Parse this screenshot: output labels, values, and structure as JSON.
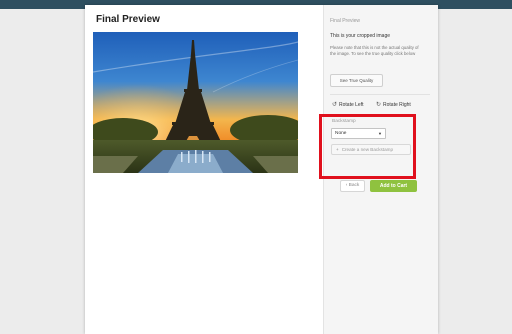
{
  "modal": {
    "title": "Final Preview",
    "close_icon": "close-icon"
  },
  "preview": {
    "image_alt": "Eiffel Tower at sunset over the Trocadéro fountains"
  },
  "sidebar": {
    "heading": "Final Preview",
    "crop_text": "This is your cropped image",
    "note": "Please note that this is not the actual quality of the image. To see the true quality click below",
    "quality_button": "See True Quality",
    "rotate_left": "Rotate Left",
    "rotate_right": "Rotate Right",
    "backstamp_label": "Backstamp",
    "backstamp_selected": "None",
    "create_backstamp": "Create a new Backstamp",
    "back_button": "Back",
    "cart_button": "Add to Cart"
  },
  "colors": {
    "header": "#2e4f60",
    "highlight": "#e0101d",
    "cart": "#8fc23f"
  }
}
